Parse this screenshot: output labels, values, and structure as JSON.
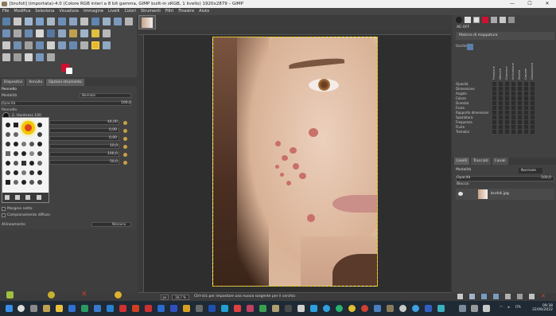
{
  "window": {
    "title": "[brufoli] (importata)-4.0 (Colore RGB interi a 8 bit gamma, GIMP built-in sRGB, 1 livello) 1920x2879 – GIMP",
    "controls": [
      "—",
      "☐",
      "✕"
    ]
  },
  "menu": [
    "File",
    "Modifica",
    "Seleziona",
    "Visualizza",
    "Immagine",
    "Livelli",
    "Colori",
    "Strumenti",
    "Filtri",
    "Finestre",
    "Aiuto"
  ],
  "left_dock": {
    "tabs": [
      "Dispositivi",
      "Annulla",
      "Opzioni strumento"
    ],
    "tool_title": "Pennello",
    "options": {
      "mode_label": "Modalità",
      "mode_value": "Normale",
      "opacity_label": "Opacità",
      "opacity_value": "100,0",
      "brush_label": "Pennello",
      "brush_name": "2. Hardness 100",
      "size_value": "44,00",
      "aspect_value": "0,00",
      "angle_value": "0,00",
      "spacing_value": "10,0",
      "hardness_value": "100,0",
      "force_value": "50,0",
      "jitter_label": "Margine netto",
      "smooth_label": "Campionamento diffuso",
      "align_label": "Allineamento",
      "align_value": "Nessuno"
    }
  },
  "canvas": {
    "ruler_marks": [
      "-1750",
      "-1500",
      "-1250",
      "-1000",
      "-750",
      "-500",
      "-250",
      "0",
      "250",
      "500",
      "750",
      "1000",
      "1250",
      "1500",
      "1750",
      "2000",
      "2250",
      "2500",
      "2750",
      "3000",
      "3250",
      "3500"
    ]
  },
  "statusbar": {
    "unit": "px",
    "zoom": "18,7 %",
    "message": "Ctrl-clic per impostare una nuova sorgente per il cerchio"
  },
  "right_dock": {
    "dynamics_label": "AE-OFF",
    "dynamics_name": "Matrice di mappatura",
    "inputs_label": "Uscite",
    "input_columns": [
      "Pressione",
      "Velocità",
      "Direzione",
      "Inclinazione",
      "Rotella",
      "Casuale",
      "Dissolvenza"
    ],
    "outputs": [
      "Opacità",
      "Dimensione",
      "Angolo",
      "Colore",
      "Durezza",
      "Forza",
      "Rapporto dimensioni",
      "Spaziatura",
      "Frequenza",
      "Fluire",
      "Tremolio"
    ],
    "layer_tabs": [
      "Livelli",
      "Tracciati",
      "Canali"
    ],
    "layer_mode_label": "Modalità",
    "layer_mode_value": "Normale",
    "opacity_label": "Opacità",
    "opacity_value": "100,0",
    "lock_label": "Blocca:",
    "layer_name": "brufoli.jpg"
  },
  "taskbar": {
    "lang": "ITA",
    "time": "09:38",
    "date": "22/06/2022"
  },
  "colors": {
    "fg": "#d01030",
    "bg": "#ffffff",
    "accent_yellow": "#e8d000"
  }
}
